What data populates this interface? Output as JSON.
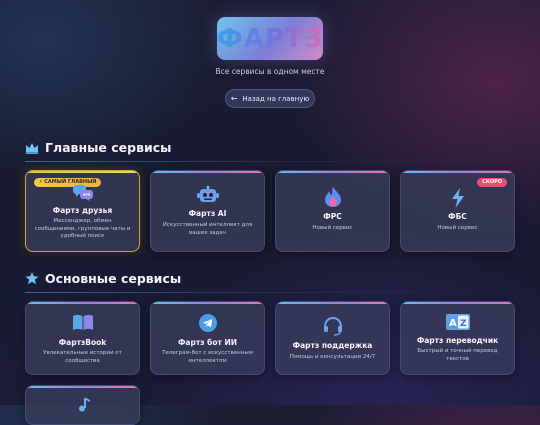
{
  "header": {
    "logo_text": "ФАРТЗ",
    "tagline": "Все сервисы в одном месте",
    "back_button": "Назад на главную"
  },
  "sections": {
    "main": {
      "title": "Главные сервисы",
      "cards": [
        {
          "badge": "⚡ САМЫЙ ГЛАВНЫЙ",
          "icon": "chat-bubbles-icon",
          "title": "Фартз друзья",
          "desc": "Мессенджер, обмен сообщениями, групповые чаты и удобный поиск"
        },
        {
          "icon": "robot-icon",
          "title": "Фартз AI",
          "desc": "Искусственный интеллект для ваших задач"
        },
        {
          "icon": "flame-icon",
          "title": "ФРС",
          "desc": "Новый сервис"
        },
        {
          "badge": "СКОРО",
          "icon": "lightning-icon",
          "title": "ФБС",
          "desc": "Новый сервис"
        }
      ]
    },
    "basic": {
      "title": "Основные сервисы",
      "cards": [
        {
          "icon": "book-icon",
          "title": "ФартзBook",
          "desc": "Увлекательные истории от сообщества"
        },
        {
          "icon": "telegram-icon",
          "title": "Фартз бот ИИ",
          "desc": "Телеграм-бот с искусственным интеллектом"
        },
        {
          "icon": "headset-icon",
          "title": "Фартз поддержка",
          "desc": "Помощь и консультации 24/7"
        },
        {
          "icon": "translate-icon",
          "title": "Фартз переводчик",
          "desc": "Быстрый и точный перевод текстов"
        },
        {
          "icon": "music-icon",
          "title": "",
          "desc": ""
        }
      ]
    }
  },
  "colors": {
    "accent_blue": "#5fc0f0",
    "accent_pink": "#ea72b8",
    "featured_gold": "#e9c14a",
    "soon_red": "#e94e6e"
  }
}
